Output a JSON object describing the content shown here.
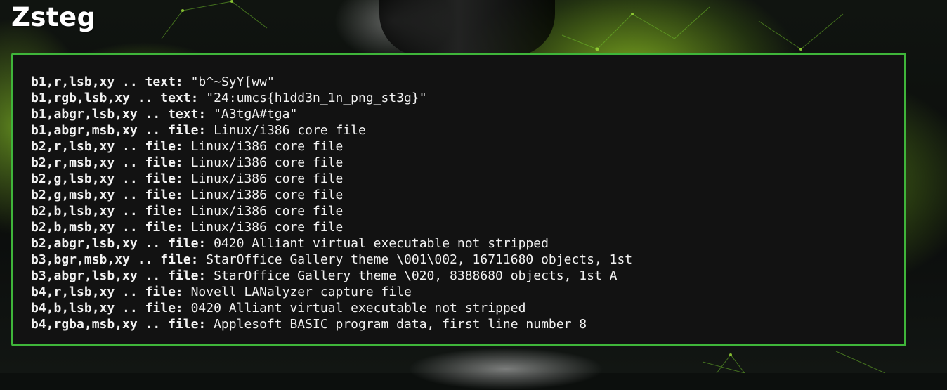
{
  "page_title": "Zsteg",
  "colors": {
    "panel_background": "#121212",
    "panel_border": "#3fb53a",
    "text": "#f2f2f2",
    "accent_green": "#8fd22a"
  },
  "output_lines": [
    {
      "key": "b1,r,lsb,xy .. text:",
      "value": "\"b^~SyY[ww\""
    },
    {
      "key": "b1,rgb,lsb,xy .. text:",
      "value": "\"24:umcs{h1dd3n_1n_png_st3g}\""
    },
    {
      "key": "b1,abgr,lsb,xy .. text:",
      "value": "\"A3tgA#tga\""
    },
    {
      "key": "b1,abgr,msb,xy .. file:",
      "value": "Linux/i386 core file"
    },
    {
      "key": "b2,r,lsb,xy .. file:",
      "value": "Linux/i386 core file"
    },
    {
      "key": "b2,r,msb,xy .. file:",
      "value": "Linux/i386 core file"
    },
    {
      "key": "b2,g,lsb,xy .. file:",
      "value": "Linux/i386 core file"
    },
    {
      "key": "b2,g,msb,xy .. file:",
      "value": "Linux/i386 core file"
    },
    {
      "key": "b2,b,lsb,xy .. file:",
      "value": "Linux/i386 core file"
    },
    {
      "key": "b2,b,msb,xy .. file:",
      "value": "Linux/i386 core file"
    },
    {
      "key": "b2,abgr,lsb,xy .. file:",
      "value": "0420 Alliant virtual executable not stripped"
    },
    {
      "key": "b3,bgr,msb,xy .. file:",
      "value": "StarOffice Gallery theme \\001\\002, 16711680 objects, 1st"
    },
    {
      "key": "b3,abgr,lsb,xy .. file:",
      "value": "StarOffice Gallery theme \\020, 8388680 objects, 1st A"
    },
    {
      "key": "b4,r,lsb,xy .. file:",
      "value": "Novell LANalyzer capture file"
    },
    {
      "key": "b4,b,lsb,xy .. file:",
      "value": "0420 Alliant virtual executable not stripped"
    },
    {
      "key": "b4,rgba,msb,xy .. file:",
      "value": "Applesoft BASIC program data, first line number 8"
    }
  ]
}
